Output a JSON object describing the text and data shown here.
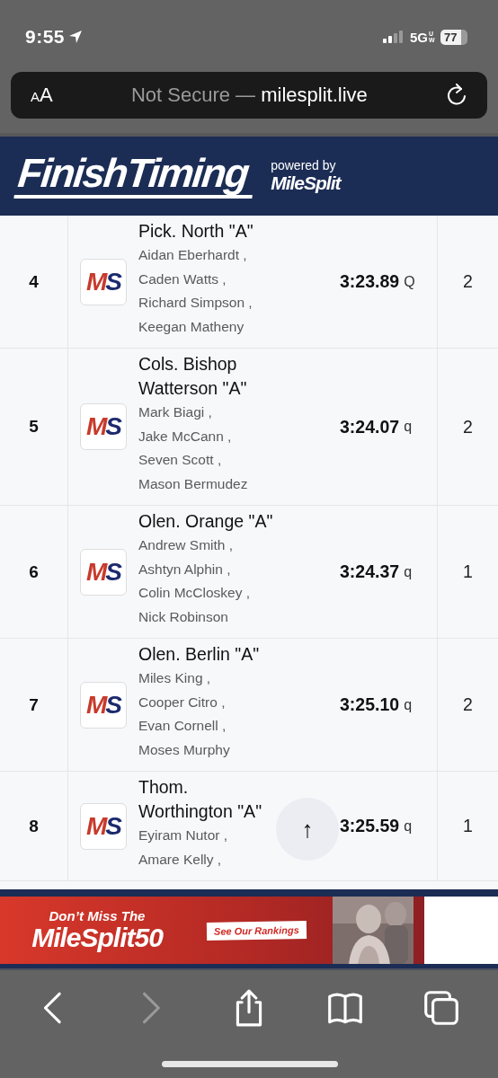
{
  "status_bar": {
    "time": "9:55",
    "network": "5G",
    "network_sub": "UW",
    "battery": "77"
  },
  "address_bar": {
    "reader": [
      "A",
      "A"
    ],
    "prefix": "Not Secure —",
    "domain": "milesplit.live"
  },
  "header": {
    "brand": "FinishTiming",
    "powered_by": "powered by",
    "partner": "MileSplit"
  },
  "results": [
    {
      "place": "4",
      "logo": [
        "M",
        "S"
      ],
      "team": "Pick. North \"A\"",
      "athletes": [
        "Aidan Eberhardt ,",
        "Caden Watts ,",
        "Richard Simpson ,",
        "Keegan Matheny"
      ],
      "time": "3:23.89",
      "mark": "Q",
      "heat": "2"
    },
    {
      "place": "5",
      "logo": [
        "M",
        "S"
      ],
      "team": "Cols. Bishop Watterson \"A\"",
      "athletes": [
        "Mark Biagi ,",
        "Jake McCann ,",
        "Seven Scott ,",
        "Mason Bermudez"
      ],
      "time": "3:24.07",
      "mark": "q",
      "heat": "2"
    },
    {
      "place": "6",
      "logo": [
        "M",
        "S"
      ],
      "team": "Olen. Orange \"A\"",
      "athletes": [
        "Andrew Smith ,",
        "Ashtyn Alphin ,",
        "Colin McCloskey ,",
        "Nick Robinson"
      ],
      "time": "3:24.37",
      "mark": "q",
      "heat": "1"
    },
    {
      "place": "7",
      "logo": [
        "M",
        "S"
      ],
      "team": "Olen. Berlin \"A\"",
      "athletes": [
        "Miles King ,",
        "Cooper Citro ,",
        "Evan Cornell ,",
        "Moses Murphy"
      ],
      "time": "3:25.10",
      "mark": "q",
      "heat": "2"
    },
    {
      "place": "8",
      "logo": [
        "M",
        "S"
      ],
      "team": "Thom. Worthington \"A\"",
      "athletes": [
        "Eyiram Nutor ,",
        "Amare Kelly ,"
      ],
      "time": "3:25.59",
      "mark": "q",
      "heat": "1"
    }
  ],
  "scroll_top": {
    "icon": "↑"
  },
  "ad": {
    "line1": "Don’t Miss The",
    "line2": "MileSplit50",
    "cta": "See Our Rankings"
  },
  "toolbar": [
    {
      "kind": "back",
      "disabled": false
    },
    {
      "kind": "forward",
      "disabled": true
    },
    {
      "kind": "share",
      "disabled": false
    },
    {
      "kind": "bookmarks",
      "disabled": false
    },
    {
      "kind": "tabs",
      "disabled": false
    }
  ]
}
